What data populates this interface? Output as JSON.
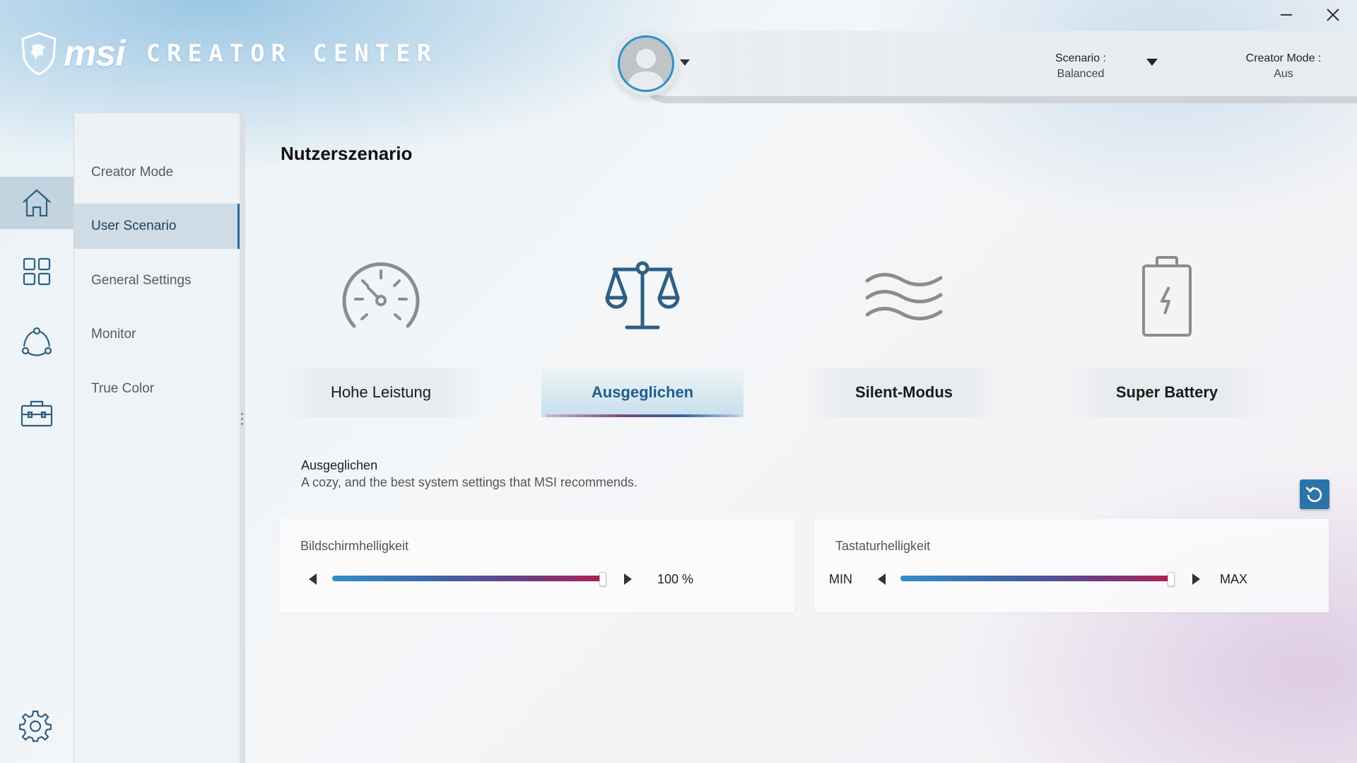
{
  "app": {
    "brand": "msi",
    "product_name": "CREATOR CENTER"
  },
  "window_controls": {
    "minimize_icon": "minimize-icon",
    "close_icon": "close-icon"
  },
  "header": {
    "scenario_label": "Scenario :",
    "scenario_value": "Balanced",
    "creator_mode_label": "Creator Mode :",
    "creator_mode_value": "Aus"
  },
  "rail": {
    "items": [
      {
        "icon": "home-icon",
        "active": true
      },
      {
        "icon": "apps-grid-icon",
        "active": false
      },
      {
        "icon": "connections-icon",
        "active": false
      },
      {
        "icon": "toolbox-icon",
        "active": false
      }
    ],
    "settings_icon": "gear-icon"
  },
  "submenu": {
    "items": [
      {
        "label": "Creator Mode"
      },
      {
        "label": "User Scenario"
      },
      {
        "label": "General Settings"
      },
      {
        "label": "Monitor"
      },
      {
        "label": "True Color"
      }
    ],
    "active_index": 1
  },
  "main": {
    "title": "Nutzerszenario",
    "modes": [
      {
        "label": "Hohe Leistung",
        "icon": "speedometer-icon"
      },
      {
        "label": "Ausgeglichen",
        "icon": "balance-scale-icon"
      },
      {
        "label": "Silent-Modus",
        "icon": "waves-icon"
      },
      {
        "label": "Super Battery",
        "icon": "battery-icon"
      }
    ],
    "selected_mode_index": 1,
    "description": {
      "title": "Ausgeglichen",
      "text": "A cozy, and the best system settings that MSI recommends."
    },
    "reset_icon": "reset-icon",
    "sliders": {
      "screen_brightness": {
        "label": "Bildschirmhelligkeit",
        "value_text": "100 %",
        "fraction": 1.0
      },
      "keyboard_brightness": {
        "label": "Tastaturhelligkeit",
        "min_label": "MIN",
        "max_label": "MAX",
        "fraction": 1.0
      }
    }
  },
  "colors": {
    "accent_blue": "#2b74a8",
    "icon_stroke": "#2f5f82",
    "selected_label": "#1f5d8c"
  }
}
